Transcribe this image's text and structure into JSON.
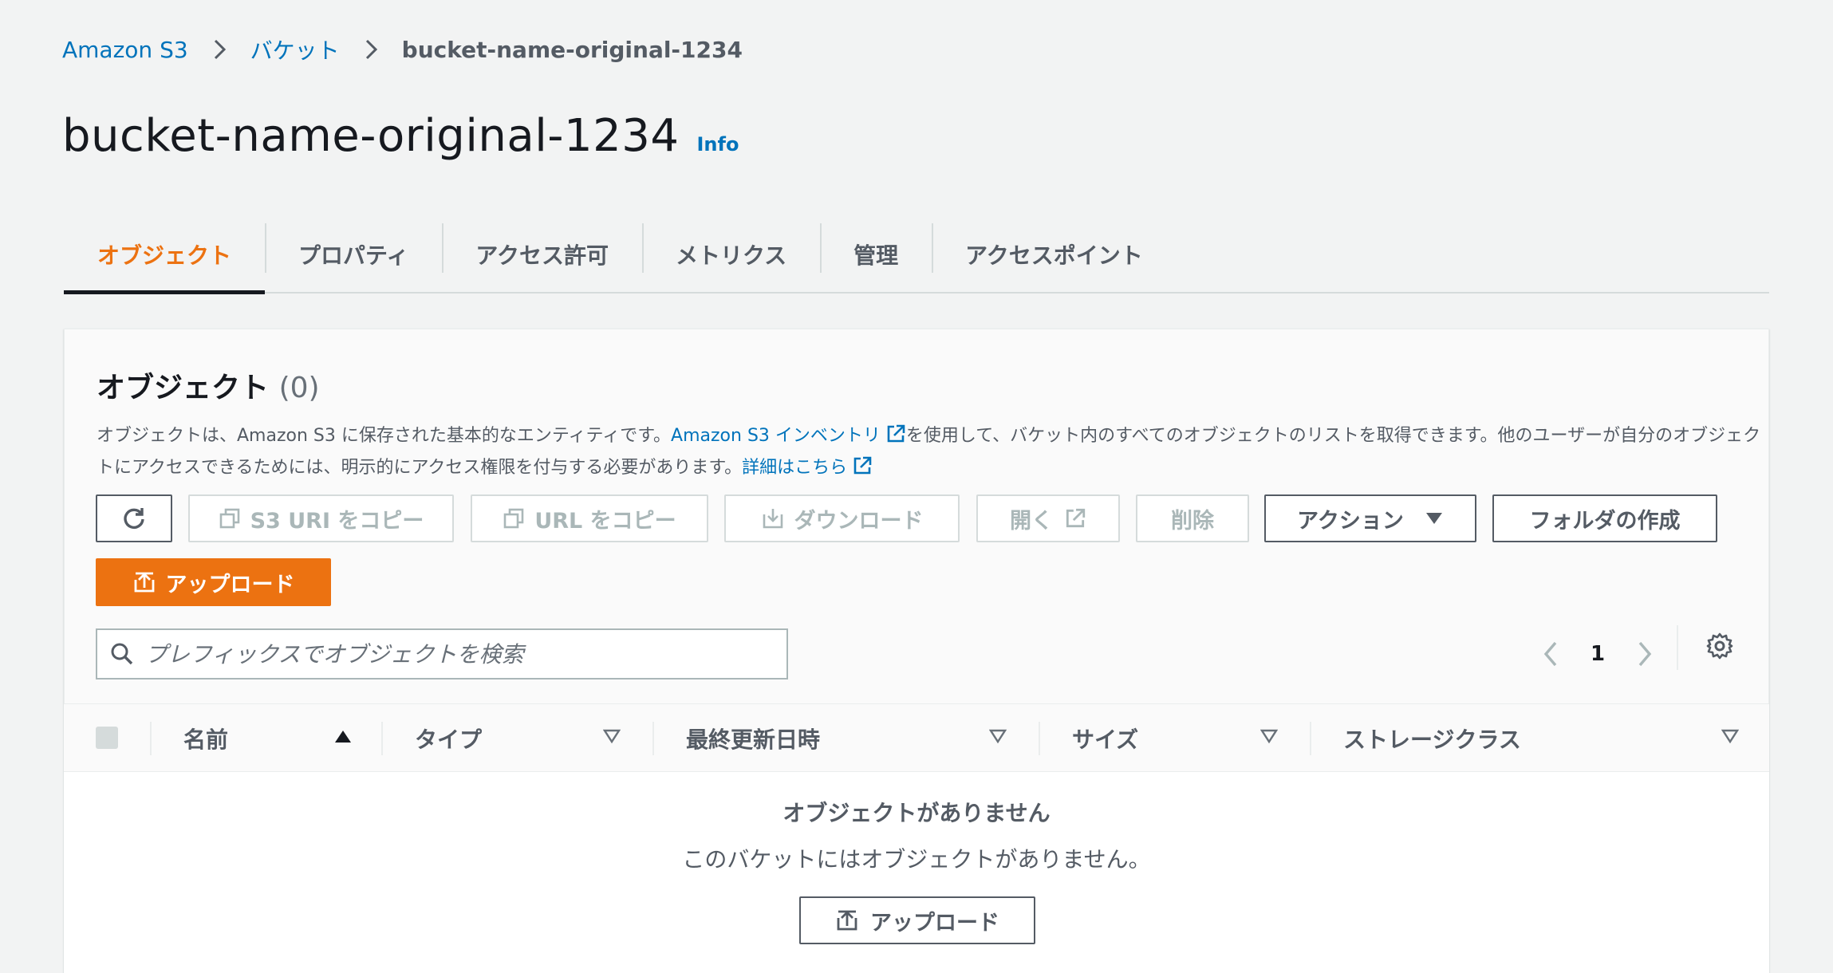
{
  "breadcrumb": {
    "root": "Amazon S3",
    "buckets": "バケット",
    "current": "bucket-name-original-1234"
  },
  "header": {
    "title": "bucket-name-original-1234",
    "info": "Info"
  },
  "tabs": [
    {
      "label": "オブジェクト",
      "active": true
    },
    {
      "label": "プロパティ"
    },
    {
      "label": "アクセス許可"
    },
    {
      "label": "メトリクス"
    },
    {
      "label": "管理"
    },
    {
      "label": "アクセスポイント"
    }
  ],
  "objects": {
    "title": "オブジェクト",
    "count": "(0)",
    "desc_part1": "オブジェクトは、Amazon S3 に保存された基本的なエンティティです。",
    "desc_link": "Amazon S3 インベントリ",
    "desc_part2": "を使用して、バケット内のすべてのオブジェクトのリストを取得できます。他のユーザーが自分のオブジェクトにアクセスできるためには、明示的にアクセス権限を付与する必要があります。",
    "desc_link2": "詳細はこちら"
  },
  "toolbar": {
    "copy_s3_uri": "S3 URI をコピー",
    "copy_url": "URL をコピー",
    "download": "ダウンロード",
    "open": "開く",
    "delete": "削除",
    "actions": "アクション",
    "create_folder": "フォルダの作成",
    "upload": "アップロード"
  },
  "search": {
    "placeholder": "プレフィックスでオブジェクトを検索"
  },
  "pagination": {
    "current_page": "1"
  },
  "table": {
    "columns": [
      "名前",
      "タイプ",
      "最終更新日時",
      "サイズ",
      "ストレージクラス"
    ],
    "empty_title": "オブジェクトがありません",
    "empty_desc": "このバケットにはオブジェクトがありません。",
    "empty_upload": "アップロード"
  },
  "colors": {
    "accent": "#ec7211",
    "link": "#0073bb",
    "text": "#16191f",
    "muted": "#545b64"
  }
}
